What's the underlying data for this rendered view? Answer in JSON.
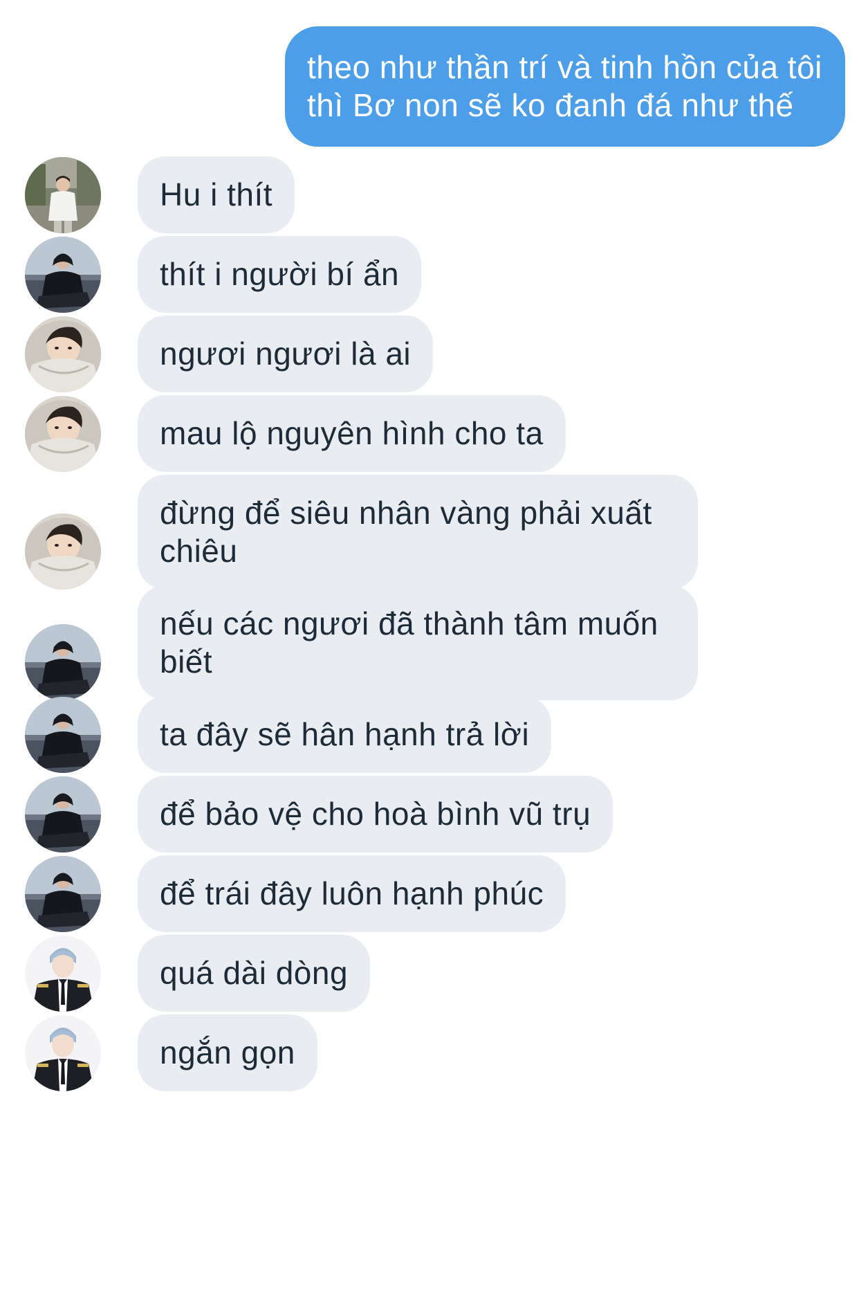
{
  "outgoing": {
    "text": "theo như thần trí và tinh hồn của tôi thì Bơ non sẽ ko đanh đá như thế"
  },
  "messages": [
    {
      "avatar": "person-outdoor-avatar",
      "text": "Hu i thít"
    },
    {
      "avatar": "person-dark-jacket-avatar",
      "text": "thít i người bí ẩn"
    },
    {
      "avatar": "person-hood-avatar",
      "text": "ngươi ngươi là ai"
    },
    {
      "avatar": "person-hood-avatar",
      "text": "mau lộ nguyên hình cho ta"
    },
    {
      "avatar": "person-hood-avatar",
      "text": "đừng để siêu nhân vàng phải xuất chiêu"
    },
    {
      "avatar": "person-dark-jacket-avatar",
      "text": "nếu các ngươi đã thành tâm muốn biết"
    },
    {
      "avatar": "person-dark-jacket-avatar",
      "text": "ta đây sẽ hân hạnh trả lời"
    },
    {
      "avatar": "person-dark-jacket-avatar",
      "text": "để bảo vệ cho hoà bình vũ trụ"
    },
    {
      "avatar": "person-dark-jacket-avatar",
      "text": "để trái đây luôn hạnh phúc"
    },
    {
      "avatar": "person-uniform-avatar",
      "text": "quá dài dòng"
    },
    {
      "avatar": "person-uniform-avatar",
      "text": "ngắn gọn"
    }
  ],
  "colors": {
    "outgoing_bubble": "#4d9ee8",
    "incoming_bubble": "#e9ecf1",
    "incoming_text": "#1d2a38",
    "background": "#ffffff"
  }
}
